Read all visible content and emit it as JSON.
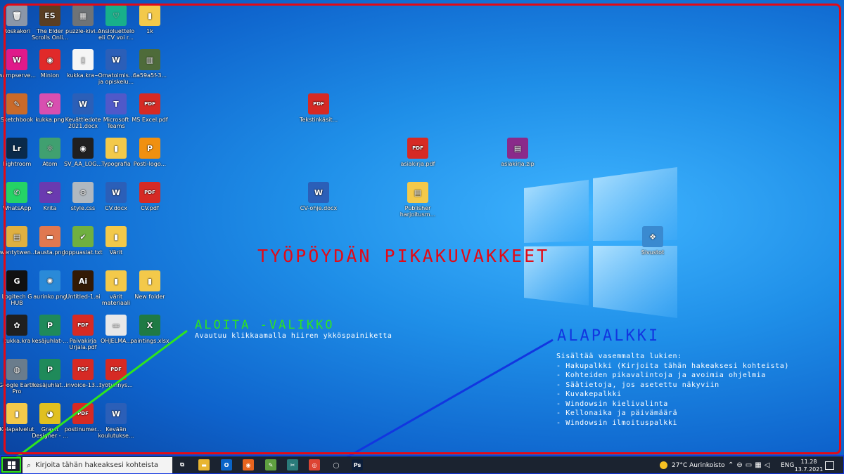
{
  "desktop": {
    "icons": [
      {
        "label": "Roskakori",
        "glyph": "🗑",
        "bg": "#8a96a8"
      },
      {
        "label": "The Elder Scrolls Onli...",
        "glyph": "ES",
        "bg": "#5a3e22"
      },
      {
        "label": "puzzle-kivi...",
        "glyph": "▦",
        "bg": "#6e7377"
      },
      {
        "label": "Ansioluettelo eli CV voi r...",
        "glyph": "♡",
        "bg": "#18b08a"
      },
      {
        "label": "1k",
        "glyph": "▮",
        "bg": "#f3c94a"
      },
      {
        "label": "wampserve...",
        "glyph": "W",
        "bg": "#e0198a"
      },
      {
        "label": "Minion",
        "glyph": "◉",
        "bg": "#e02a2a"
      },
      {
        "label": "kukka.kra~",
        "glyph": "▯",
        "bg": "#f5f5f5"
      },
      {
        "label": "Omatoimis... ja opiskelu...",
        "glyph": "W",
        "bg": "#2b5fb8"
      },
      {
        "label": "6a59a5f-3...",
        "glyph": "▥",
        "bg": "#4e6b3a"
      },
      {
        "label": "Sketchbook",
        "glyph": "✎",
        "bg": "#c96a2a"
      },
      {
        "label": "kukka.png",
        "glyph": "✿",
        "bg": "#d84fb0"
      },
      {
        "label": "Kevättiedote 2021.docx",
        "glyph": "W",
        "bg": "#2b5fb8"
      },
      {
        "label": "Microsoft Teams",
        "glyph": "T",
        "bg": "#5059c9"
      },
      {
        "label": "MS Excel.pdf",
        "glyph": "PDF",
        "bg": "#d62a24"
      },
      {
        "label": "Lightroom",
        "glyph": "Lr",
        "bg": "#0a2a4a"
      },
      {
        "label": "Atom",
        "glyph": "⚛",
        "bg": "#40a070"
      },
      {
        "label": "SV_AA_LOG...",
        "glyph": "◉",
        "bg": "#202020"
      },
      {
        "label": "Typografia",
        "glyph": "▮",
        "bg": "#f3c94a"
      },
      {
        "label": "Posti-logo...",
        "glyph": "P",
        "bg": "#f09010"
      },
      {
        "label": "WhatsApp",
        "glyph": "✆",
        "bg": "#25d366"
      },
      {
        "label": "Krita",
        "glyph": "✒",
        "bg": "#6a3ab0"
      },
      {
        "label": "style.css",
        "glyph": "⚙",
        "bg": "#b0b8c0"
      },
      {
        "label": "CV.docx",
        "glyph": "W",
        "bg": "#2b5fb8"
      },
      {
        "label": "CV.pdf",
        "glyph": "PDF",
        "bg": "#d62a24"
      },
      {
        "label": "twentytwen...",
        "glyph": "▤",
        "bg": "#e0b040"
      },
      {
        "label": "tausta.png",
        "glyph": "▬",
        "bg": "#e07850"
      },
      {
        "label": "loppuasiat.txt",
        "glyph": "✔",
        "bg": "#70b040"
      },
      {
        "label": "Värit",
        "glyph": "▮",
        "bg": "#f3c94a"
      },
      {
        "label": "Logitech G HUB",
        "glyph": "G",
        "bg": "#111111"
      },
      {
        "label": "aurinko.png",
        "glyph": "✺",
        "bg": "#2a8ad8"
      },
      {
        "label": "Untitled-1.ai",
        "glyph": "Ai",
        "bg": "#331a05"
      },
      {
        "label": "värit materiaali",
        "glyph": "▮",
        "bg": "#f3c94a"
      },
      {
        "label": "New folder",
        "glyph": "▮",
        "bg": "#f3c94a"
      },
      {
        "label": "kukka.kra",
        "glyph": "✿",
        "bg": "#202020"
      },
      {
        "label": "kesäjuhlat-...",
        "glyph": "P",
        "bg": "#1f8a5a"
      },
      {
        "label": "Paivakirja Urjala.pdf",
        "glyph": "PDF",
        "bg": "#d62a24"
      },
      {
        "label": "OHJELMA...",
        "glyph": "▭",
        "bg": "#e8e8e8"
      },
      {
        "label": "paintings.xlsx",
        "glyph": "X",
        "bg": "#1f7a44"
      },
      {
        "label": "Google Earth Pro",
        "glyph": "◍",
        "bg": "#6a7c8c"
      },
      {
        "label": "kesäjuhlat...",
        "glyph": "P",
        "bg": "#1f8a5a"
      },
      {
        "label": "invoice-13...",
        "glyph": "PDF",
        "bg": "#d62a24"
      },
      {
        "label": "työtunnys...",
        "glyph": "PDF",
        "bg": "#d62a24"
      },
      {
        "label": "Kelapalvelut",
        "glyph": "▮",
        "bg": "#f3c94a"
      },
      {
        "label": "Gravit Designer - ...",
        "glyph": "◕",
        "bg": "#e0c020"
      },
      {
        "label": "postinumer...",
        "glyph": "PDF",
        "bg": "#d62a24"
      },
      {
        "label": "Kevään koulutukse...",
        "glyph": "W",
        "bg": "#2b5fb8"
      },
      {
        "label": "Tekstinkäsit...",
        "glyph": "PDF",
        "bg": "#d62a24"
      },
      {
        "label": "asiakirja.pdf",
        "glyph": "PDF",
        "bg": "#d62a24"
      },
      {
        "label": "asiakirja.zip",
        "glyph": "▤",
        "bg": "#8a2a8a"
      },
      {
        "label": "CV-ohje.docx",
        "glyph": "W",
        "bg": "#2b5fb8"
      },
      {
        "label": "Publisher harjoitusm...",
        "glyph": "▤",
        "bg": "#f3c94a"
      },
      {
        "label": "Sivustot",
        "glyph": "❖",
        "bg": "#3a8ad0"
      }
    ]
  },
  "annotations": {
    "desktop_title": "TYÖPÖYDÄN PIKAKUVAKKEET",
    "start_title": "ALOITA -VALIKKO",
    "start_desc": "Avautuu klikkaamalla hiiren ykköspainiketta",
    "taskbar_title": "ALAPALKKI",
    "taskbar_desc": [
      "Sisältää vasemmalta lukien:",
      "- Hakupalkki (Kirjoita tähän hakeaksesi kohteista)",
      "- Kohteiden pikavalintoja ja avoimia ohjelmia",
      "- Säätietoja, jos asetettu näkyviin",
      "- Kuvakepalkki",
      "- Windowsin kielivalinta",
      "- Kellonaika ja päivämäärä",
      "- Windowsin ilmoituspalkki"
    ],
    "colors": {
      "red": "#e30a16",
      "green": "#2ee51e",
      "blue": "#1236e0"
    }
  },
  "taskbar": {
    "search_placeholder": "Kirjoita tähän hakeaksesi kohteista",
    "pinned": [
      {
        "name": "task-view-icon",
        "glyph": "⧉",
        "bg": "#1b2330"
      },
      {
        "name": "file-explorer-icon",
        "glyph": "▬",
        "bg": "#e8b530"
      },
      {
        "name": "outlook-icon",
        "glyph": "O",
        "bg": "#0a64c8"
      },
      {
        "name": "firefox-icon",
        "glyph": "◉",
        "bg": "#e8641e"
      },
      {
        "name": "notepad-icon",
        "glyph": "✎",
        "bg": "#5fa040"
      },
      {
        "name": "snipping-icon",
        "glyph": "✂",
        "bg": "#2a7a7a"
      },
      {
        "name": "chrome-icon",
        "glyph": "◎",
        "bg": "#dd4433"
      },
      {
        "name": "obs-icon",
        "glyph": "◯",
        "bg": "#1b2330"
      },
      {
        "name": "photoshop-icon",
        "glyph": "Ps",
        "bg": "#0c1e3a"
      }
    ],
    "weather": "27°C  Aurinkoisto",
    "language": "ENG",
    "time": "11.28",
    "date": "13.7.2021"
  }
}
